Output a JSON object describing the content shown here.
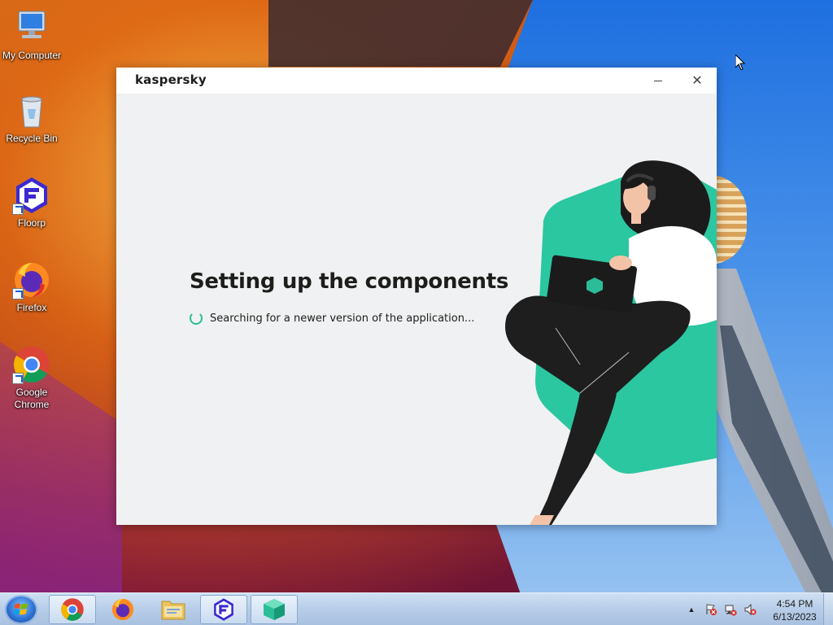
{
  "desktop": {
    "icons": [
      {
        "label": "My Computer",
        "icon": "computer-icon"
      },
      {
        "label": "Recycle Bin",
        "icon": "recycle-bin-icon"
      },
      {
        "label": "Floorp",
        "icon": "floorp-icon"
      },
      {
        "label": "Firefox",
        "icon": "firefox-icon"
      },
      {
        "label": "Google Chrome",
        "icon": "chrome-icon"
      }
    ]
  },
  "window": {
    "brand": "kaspersky",
    "minimize_symbol": "",
    "close_symbol": "✕",
    "title": "Setting up the components",
    "status": "Searching for a newer version of the application...",
    "accent_color": "#2bbd97"
  },
  "taskbar": {
    "apps": [
      {
        "name": "Google Chrome",
        "icon": "chrome-icon",
        "active": true
      },
      {
        "name": "Firefox",
        "icon": "firefox-icon",
        "active": false
      },
      {
        "name": "Windows Explorer",
        "icon": "folder-icon",
        "active": false
      },
      {
        "name": "Floorp",
        "icon": "floorp-icon",
        "active": false
      },
      {
        "name": "Kaspersky Setup",
        "icon": "kaspersky-box-icon",
        "active": false
      }
    ],
    "tray": {
      "show_hidden_symbol": "▲",
      "time": "4:54 PM",
      "date": "6/13/2023"
    }
  }
}
